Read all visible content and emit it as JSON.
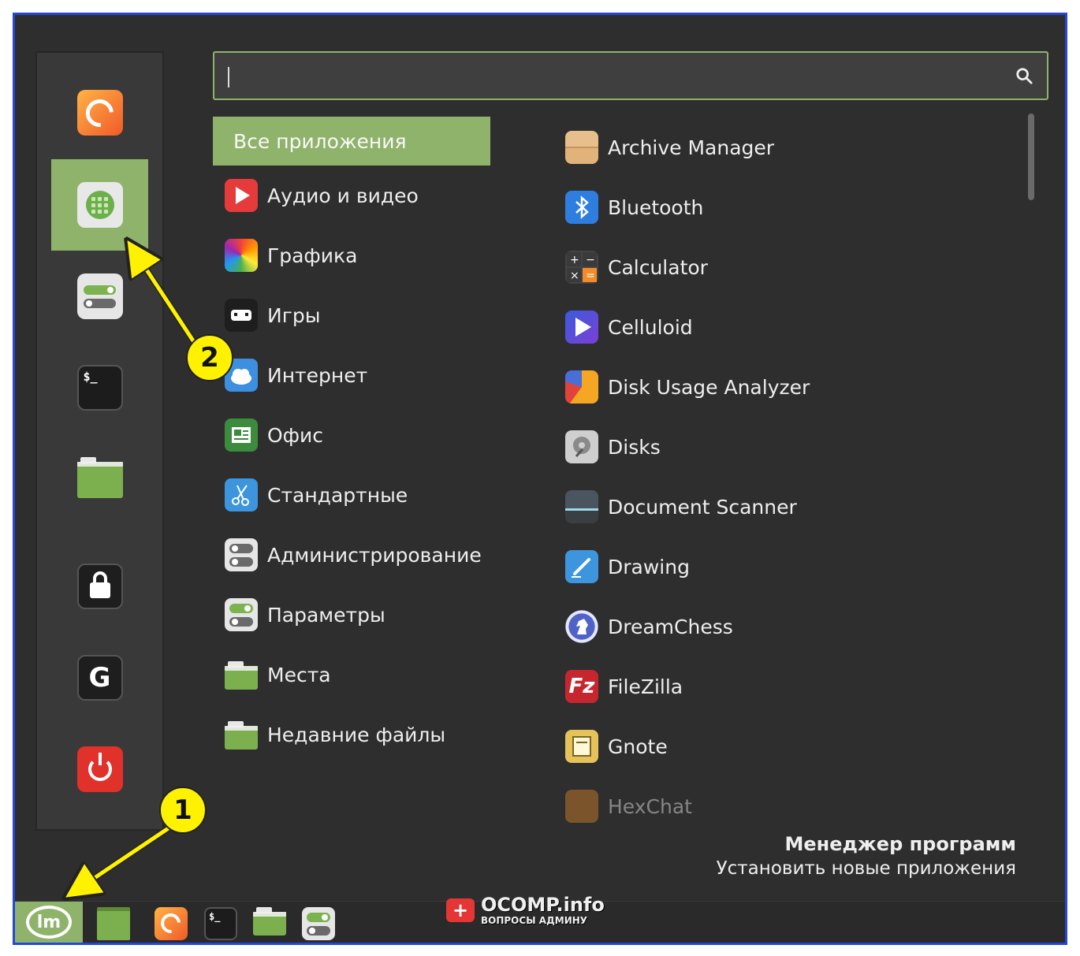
{
  "search": {
    "value": "",
    "placeholder": ""
  },
  "favorites": [
    {
      "name": "firefox",
      "icon": "firefox-icon"
    },
    {
      "name": "mint-menu",
      "icon": "app-grid-icon",
      "active": true
    },
    {
      "name": "settings",
      "icon": "toggles-icon"
    },
    {
      "name": "terminal",
      "icon": "terminal-icon",
      "glyph": "$_"
    },
    {
      "name": "files",
      "icon": "folder-icon"
    },
    {
      "name": "lock-screen",
      "icon": "lock-icon"
    },
    {
      "name": "logout",
      "icon": "logout-icon",
      "glyph": "G"
    },
    {
      "name": "shutdown",
      "icon": "power-icon"
    }
  ],
  "categories": [
    {
      "label": "Все приложения",
      "active": true
    },
    {
      "label": "Аудио и видео",
      "icon": "play-icon",
      "color": "#e53b3b"
    },
    {
      "label": "Графика",
      "icon": "graphics-icon",
      "color": "#c64bd6"
    },
    {
      "label": "Игры",
      "icon": "gamepad-icon",
      "color": "#1e1e1e"
    },
    {
      "label": "Интернет",
      "icon": "cloud-icon",
      "color": "#3d8fe0"
    },
    {
      "label": "Офис",
      "icon": "office-icon",
      "color": "#3d8b3d"
    },
    {
      "label": "Стандартные",
      "icon": "scissors-icon",
      "color": "#3c95dd"
    },
    {
      "label": "Администрирование",
      "icon": "toggles-icon",
      "color": "#d7d7d7"
    },
    {
      "label": "Параметры",
      "icon": "toggles-icon",
      "color": "#d7d7d7"
    },
    {
      "label": "Места",
      "icon": "folder-icon",
      "color": "#7cb04f"
    },
    {
      "label": "Недавние файлы",
      "icon": "recent-folder-icon",
      "color": "#7cb04f"
    }
  ],
  "apps": [
    {
      "label": "Archive Manager",
      "icon": "archive-icon",
      "color": "#d9a86c"
    },
    {
      "label": "Bluetooth",
      "icon": "bluetooth-icon",
      "color": "#2e7ee0"
    },
    {
      "label": "Calculator",
      "icon": "calculator-icon",
      "color": "#444444"
    },
    {
      "label": "Celluloid",
      "icon": "play-icon",
      "color": "#3b5bdb"
    },
    {
      "label": "Disk Usage Analyzer",
      "icon": "pie-chart-icon",
      "color": "#f5a623"
    },
    {
      "label": "Disks",
      "icon": "disk-icon",
      "color": "#cfcfcf"
    },
    {
      "label": "Document Scanner",
      "icon": "scanner-icon",
      "color": "#4a5560"
    },
    {
      "label": "Drawing",
      "icon": "pencil-icon",
      "color": "#3c95dd"
    },
    {
      "label": "DreamChess",
      "icon": "chess-knight-icon",
      "color": "#5062c8"
    },
    {
      "label": "FileZilla",
      "icon": "filezilla-icon",
      "color": "#c6262e"
    },
    {
      "label": "Gnote",
      "icon": "note-icon",
      "color": "#e6c35a"
    },
    {
      "label": "HexChat",
      "icon": "hexchat-icon",
      "color": "#d9822b",
      "faded": true
    }
  ],
  "app_info": {
    "name": "Менеджер программ",
    "description": "Установить новые приложения"
  },
  "taskbar": {
    "items": [
      {
        "name": "mint-menu",
        "icon": "mint-logo-icon",
        "active": true
      },
      {
        "name": "show-desktop",
        "icon": "desktop-icon"
      },
      {
        "name": "firefox",
        "icon": "firefox-icon",
        "running": true
      },
      {
        "name": "terminal",
        "icon": "terminal-icon",
        "glyph": "$_"
      },
      {
        "name": "files",
        "icon": "folder-icon"
      },
      {
        "name": "settings",
        "icon": "toggles-icon",
        "running": true
      }
    ]
  },
  "watermark": {
    "badge": "+",
    "title": "OCOMP.info",
    "subtitle": "ВОПРОСЫ АДМИНУ"
  },
  "annotations": [
    {
      "number": "1",
      "target": "mint-menu taskbar button"
    },
    {
      "number": "2",
      "target": "mint-menu favorite"
    }
  ],
  "colors": {
    "accent": "#8fb36b",
    "frame": "#2448d6",
    "badge": "#fff200"
  }
}
